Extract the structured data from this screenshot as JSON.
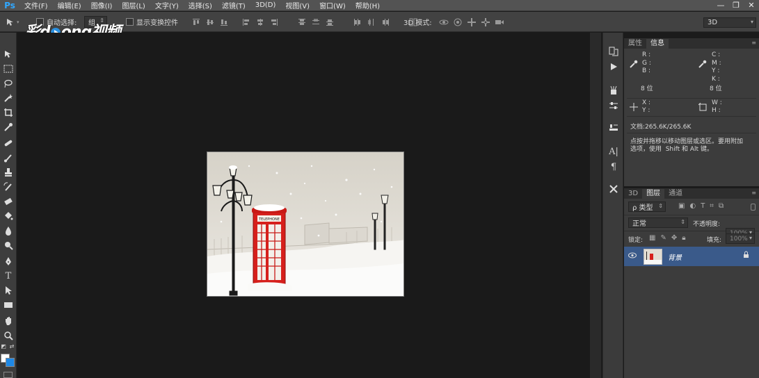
{
  "app": {
    "logo": "Ps"
  },
  "menu": [
    "文件(F)",
    "编辑(E)",
    "图像(I)",
    "图层(L)",
    "文字(Y)",
    "选择(S)",
    "滤镜(T)",
    "3D(D)",
    "视图(V)",
    "窗口(W)",
    "帮助(H)"
  ],
  "window_controls": [
    "—",
    "❐",
    "✕"
  ],
  "options": {
    "auto_select_label": "自动选择:",
    "auto_select_value": "组",
    "show_transform_label": "显示变换控件",
    "mode_3d_label": "3D 模式:",
    "workspace_value": "3D"
  },
  "watermark": {
    "before": "彩",
    "after": "ong视频",
    "d": "d"
  },
  "info_panel": {
    "tabs": [
      "属性",
      "信息"
    ],
    "rgb_labels": "R :\nG :\nB :",
    "cmyk_labels": "C :\nM :\nY :\nK :",
    "bit_left": "8 位",
    "bit_right": "8 位",
    "xy_labels": "X :\nY :",
    "wh_labels": "W :\nH :",
    "doc_size": "文档:265.6K/265.6K",
    "hint": "点按并拖移以移动图层或选区。要用附加\n选项，使用  Shift 和 Alt 键。"
  },
  "layers_panel": {
    "tabs": [
      "3D",
      "图层",
      "通道"
    ],
    "filter_type": "ρ 类型",
    "blend_mode": "正常",
    "opacity_label": "不透明度:",
    "opacity_value": "100%",
    "lock_label": "锁定:",
    "fill_label": "填充:",
    "fill_value": "100%",
    "layer_name": "背景"
  },
  "document": {
    "booth_sign": "TELEPHONE"
  },
  "colors": {
    "foreground": "#ffffff",
    "background": "#1e88e5",
    "accent": "#31a8ff"
  }
}
